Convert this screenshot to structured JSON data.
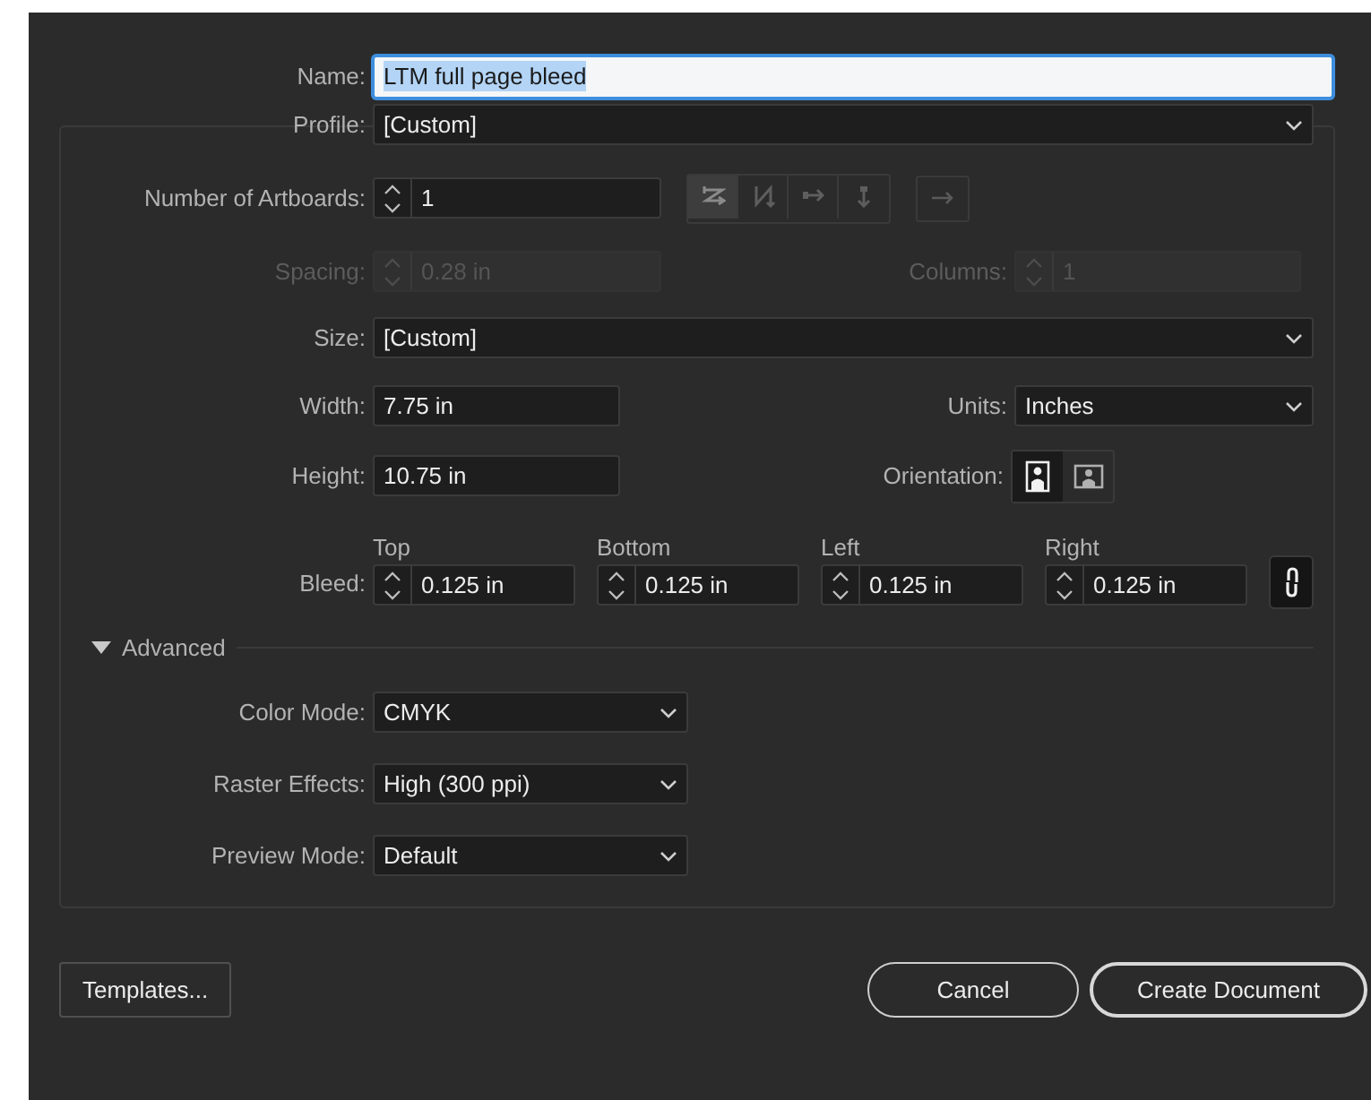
{
  "name_field": {
    "label": "Name:",
    "value": "LTM full page bleed",
    "text_selected": true
  },
  "profile": {
    "label": "Profile:",
    "value": "[Custom]"
  },
  "artboards": {
    "label": "Number of Artboards:",
    "value": "1",
    "arrangement_disabled": true,
    "arrangement": [
      {
        "kind": "grid-row",
        "selected": true
      },
      {
        "kind": "grid-column",
        "selected": false
      },
      {
        "kind": "row",
        "selected": false
      },
      {
        "kind": "column",
        "selected": false
      }
    ],
    "direction": {
      "kind": "right-to-left"
    }
  },
  "spacing": {
    "label": "Spacing:",
    "value": "0.28 in",
    "disabled": true
  },
  "columns": {
    "label": "Columns:",
    "value": "1",
    "disabled": true
  },
  "size": {
    "label": "Size:",
    "value": "[Custom]"
  },
  "width": {
    "label": "Width:",
    "value": "7.75 in"
  },
  "units": {
    "label": "Units:",
    "value": "Inches"
  },
  "height": {
    "label": "Height:",
    "value": "10.75 in"
  },
  "orientation": {
    "label": "Orientation:",
    "options": [
      {
        "kind": "portrait",
        "selected": true
      },
      {
        "kind": "landscape",
        "selected": false
      }
    ]
  },
  "bleed": {
    "label": "Bleed:",
    "linked": true,
    "sides": [
      {
        "heading": "Top",
        "value": "0.125 in"
      },
      {
        "heading": "Bottom",
        "value": "0.125 in"
      },
      {
        "heading": "Left",
        "value": "0.125 in"
      },
      {
        "heading": "Right",
        "value": "0.125 in"
      }
    ]
  },
  "advanced": {
    "label": "Advanced",
    "expanded": true,
    "fields": [
      {
        "label": "Color Mode:",
        "value": "CMYK"
      },
      {
        "label": "Raster Effects:",
        "value": "High (300 ppi)"
      },
      {
        "label": "Preview Mode:",
        "value": "Default"
      }
    ]
  },
  "buttons": [
    {
      "label": "Templates...",
      "kind": "secondary"
    },
    {
      "label": "Cancel",
      "kind": "pill"
    },
    {
      "label": "Create Document",
      "kind": "default"
    }
  ]
}
